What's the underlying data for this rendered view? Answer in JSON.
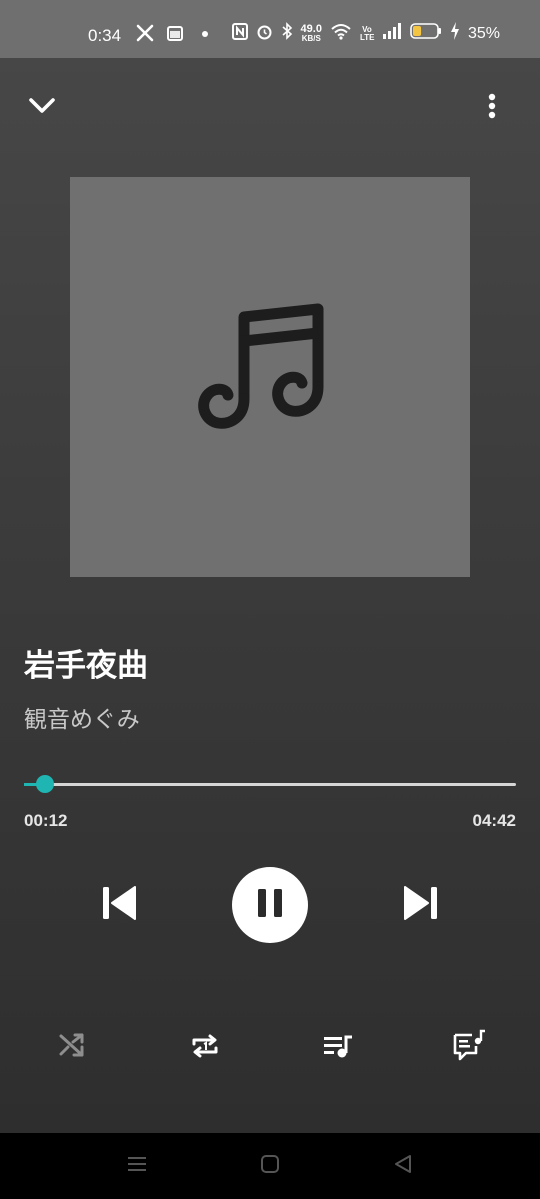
{
  "status_bar": {
    "time": "0:34",
    "network_speed_value": "49.0",
    "network_speed_unit": "KB/S",
    "volte_label": "Vo LTE",
    "battery_percent": "35%",
    "battery_level": 0.35,
    "left_icons": [
      "x-logo-icon",
      "calendar-icon",
      "dot-icon"
    ],
    "right_icons": [
      "nfc-icon",
      "alarm-icon",
      "bluetooth-icon",
      "wifi-icon",
      "signal-icon",
      "battery-icon",
      "charging-icon"
    ]
  },
  "header": {
    "collapse_icon": "chevron-down-icon",
    "menu_icon": "more-vertical-icon"
  },
  "album_art": {
    "placeholder_icon": "music-note-icon",
    "background": "#707070"
  },
  "track": {
    "title": "岩手夜曲",
    "artist": "観音めぐみ"
  },
  "progress": {
    "elapsed": "00:12",
    "total": "04:42",
    "fraction": 0.042,
    "accent_color": "#1fb5b3"
  },
  "controls": {
    "previous_icon": "skip-previous-icon",
    "play_pause_icon": "pause-icon",
    "next_icon": "skip-next-icon"
  },
  "bottom_actions": {
    "shuffle_icon": "shuffle-icon",
    "repeat_icon": "repeat-one-icon",
    "queue_icon": "queue-music-icon",
    "lyrics_icon": "lyrics-icon"
  },
  "nav_bar": {
    "icons": [
      "recents-icon",
      "home-icon",
      "back-icon"
    ]
  }
}
